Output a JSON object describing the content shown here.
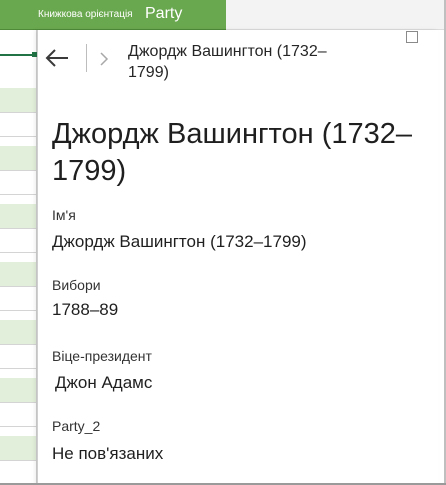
{
  "ribbon": {
    "tab_orientation": "Книжкова орієнтація",
    "tab_party": "Party"
  },
  "card": {
    "header_title": "Джордж Вашингтон (1732–1799)",
    "title": "Джордж Вашингтон (1732–1799)",
    "back_icon": "arrow-left-icon",
    "forward_icon": "chevron-right-icon",
    "fields": [
      {
        "label": "Ім'я",
        "value": "Джордж Вашингтон (1732–1799)"
      },
      {
        "label": "Вибори",
        "value": "1788–89"
      },
      {
        "label": "Віце-президент",
        "value": "Джон Адамс"
      },
      {
        "label": "Party_2",
        "value": "Не пов'язаних"
      }
    ]
  },
  "colors": {
    "ribbon_green": "#6aa84f",
    "row_green": "#e2efda",
    "cursor_green": "#217346"
  }
}
